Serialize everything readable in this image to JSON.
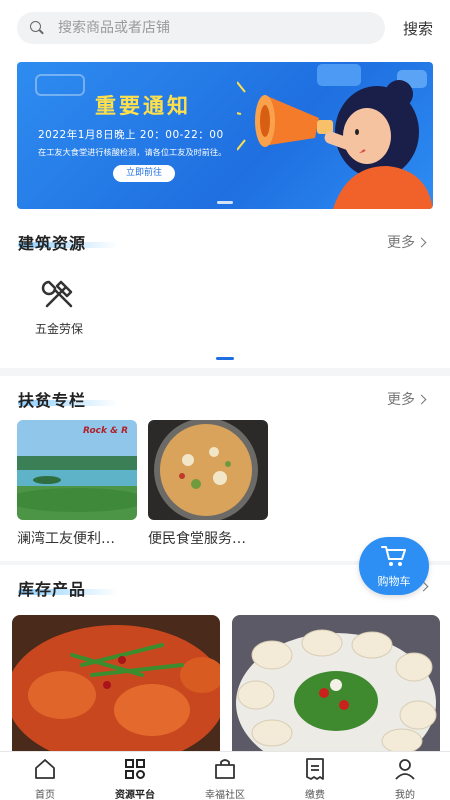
{
  "search": {
    "placeholder": "搜索商品或者店铺",
    "button_label": "搜索"
  },
  "banner": {
    "title": "重要通知",
    "date_line": "2022年1月8日晚上 20：00-22：00",
    "desc_line": "在工友大食堂进行核酸检测，请各位工友及时前往。",
    "button_label": "立即前往"
  },
  "sections": {
    "construction": {
      "title": "建筑资源",
      "more_label": "更多",
      "items": [
        {
          "label": "五金劳保",
          "icon": "wrench-hammer-icon"
        }
      ]
    },
    "poverty": {
      "title": "扶贫专栏",
      "more_label": "更多",
      "cards": [
        {
          "caption": "澜湾工友便利…",
          "image": "lake-landscape",
          "sign_text": "Rock & R"
        },
        {
          "caption": "便民食堂服务…",
          "image": "soup-bowl"
        }
      ]
    },
    "inventory": {
      "title": "库存产品",
      "products": [
        {
          "image": "crab-dish"
        },
        {
          "image": "dumplings-dish"
        }
      ]
    }
  },
  "cart": {
    "label": "购物车",
    "icon": "cart-icon"
  },
  "tabbar": {
    "tabs": [
      {
        "label": "首页",
        "icon": "home-icon"
      },
      {
        "label": "资源平台",
        "icon": "grid-icon",
        "active": true
      },
      {
        "label": "幸福社区",
        "icon": "bag-icon"
      },
      {
        "label": "缴费",
        "icon": "bill-icon"
      },
      {
        "label": "我的",
        "icon": "person-icon"
      }
    ]
  },
  "colors": {
    "accent": "#1f6fe0",
    "banner_title": "#ffe04a",
    "cart": "#2d8ff3"
  }
}
